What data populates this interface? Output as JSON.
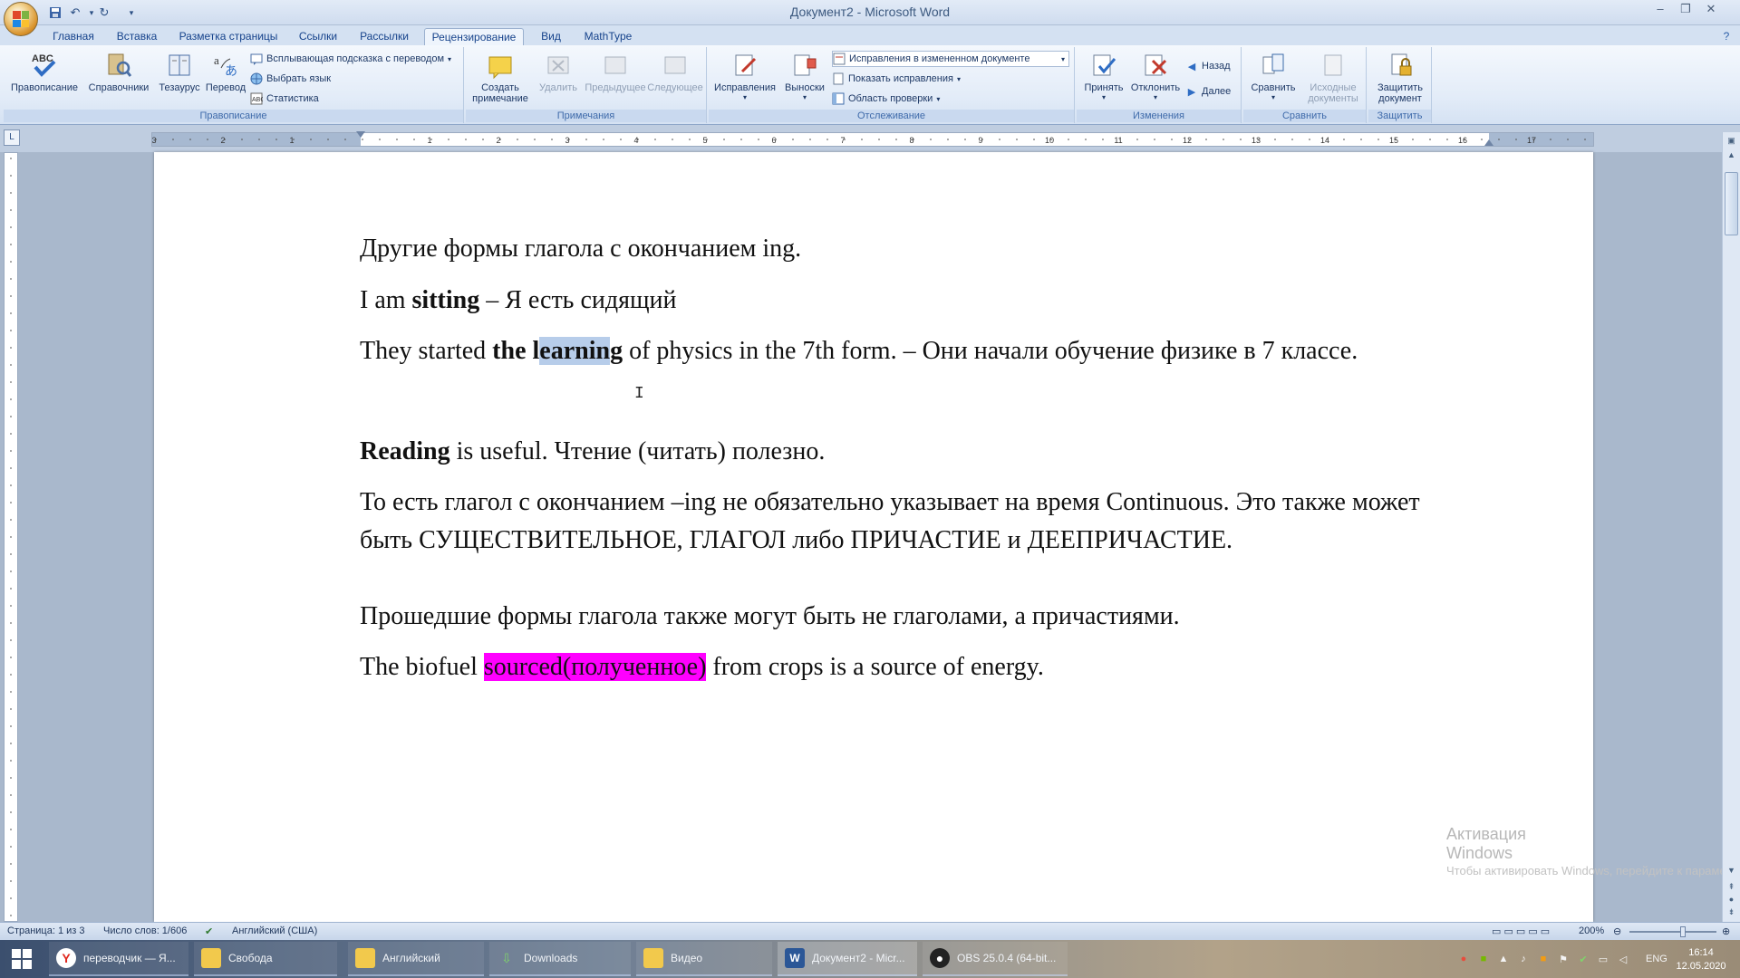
{
  "window": {
    "title": "Документ2 - Microsoft Word"
  },
  "tabs": [
    "Главная",
    "Вставка",
    "Разметка страницы",
    "Ссылки",
    "Рассылки",
    "Рецензирование",
    "Вид",
    "MathType"
  ],
  "active_tab": "Рецензирование",
  "ribbon": {
    "groups": {
      "proofing": "Правописание",
      "comments": "Примечания",
      "tracking": "Отслеживание",
      "changes": "Изменения",
      "compare": "Сравнить",
      "protect": "Защитить"
    },
    "spelling": "Правописание",
    "research": "Справочники",
    "thesaurus": "Тезаурус",
    "translate": "Перевод",
    "translation_tooltip": "Всплывающая подсказка с переводом",
    "set_language": "Выбрать язык",
    "word_count": "Статистика",
    "new_comment_1": "Создать",
    "new_comment_2": "примечание",
    "delete": "Удалить",
    "previous": "Предыдущее",
    "next": "Следующее",
    "track_changes": "Исправления",
    "balloons": "Выноски",
    "display_for_review": "Исправления в измененном документе",
    "show_markup": "Показать исправления",
    "reviewing_pane": "Область проверки",
    "accept": "Принять",
    "reject": "Отклонить",
    "prev_change": "Назад",
    "next_change": "Далее",
    "compare": "Сравнить",
    "source_docs_1": "Исходные",
    "source_docs_2": "документы",
    "protect_1": "Защитить",
    "protect_2": "документ"
  },
  "ruler": {
    "labels": [
      "3",
      "2",
      "1",
      "1",
      "2",
      "3",
      "4",
      "5",
      "6",
      "7",
      "8",
      "9",
      "10",
      "11",
      "12",
      "13",
      "14",
      "15",
      "16",
      "17"
    ]
  },
  "document": {
    "p1": "Другие формы глагола с окончанием ing.",
    "p2": {
      "a": "I am ",
      "b": "sitting",
      "c": " – Я есть сидящий"
    },
    "p3": {
      "a": "They started ",
      "b1": "the l",
      "b2": "earnin",
      "b3": "g",
      "c": " of physics  in the 7th form. – Они начали обучение физике в 7 классе."
    },
    "p4": {
      "a": "Reading",
      "b": " is useful.  Чтение (читать) полезно."
    },
    "p5": "То есть глагол с окончанием –ing не обязательно указывает на время Continuous.  Это также может быть СУЩЕСТВИТЕЛЬНОЕ, ГЛАГОЛ либо ПРИЧАСТИЕ и ДЕЕПРИЧАСТИЕ.",
    "p6": "Прошедшие формы глагола также могут быть не глаголами, а причастиями.",
    "p7": {
      "a": "The biofuel ",
      "b": "sourced(полученное)",
      "c": " from crops is a source of energy."
    }
  },
  "watermark": {
    "title": "Активация Windows",
    "subtitle": "Чтобы активировать Windows, перейдите к параметрам компьютера."
  },
  "statusbar": {
    "page": "Страница: 1 из 3",
    "words": "Число слов: 1/606",
    "language": "Английский (США)",
    "zoom": "200%"
  },
  "taskbar": {
    "items": [
      {
        "label": "переводчик — Я...",
        "icon": "yandex-browser-icon"
      },
      {
        "label": "Свобода",
        "icon": "folder-icon"
      },
      {
        "label": "Английский",
        "icon": "folder-icon"
      },
      {
        "label": "Downloads",
        "icon": "downloads-icon"
      },
      {
        "label": "Видео",
        "icon": "folder-icon"
      },
      {
        "label": "Документ2 - Micr...",
        "icon": "word-icon"
      },
      {
        "label": "OBS 25.0.4 (64-bit...",
        "icon": "obs-icon"
      }
    ],
    "lang": "ENG",
    "time": "16:14",
    "date": "12.05.2020"
  },
  "colors": {
    "accent": "#15428b",
    "selection": "#b7cdea",
    "highlight": "#ff00ff"
  }
}
